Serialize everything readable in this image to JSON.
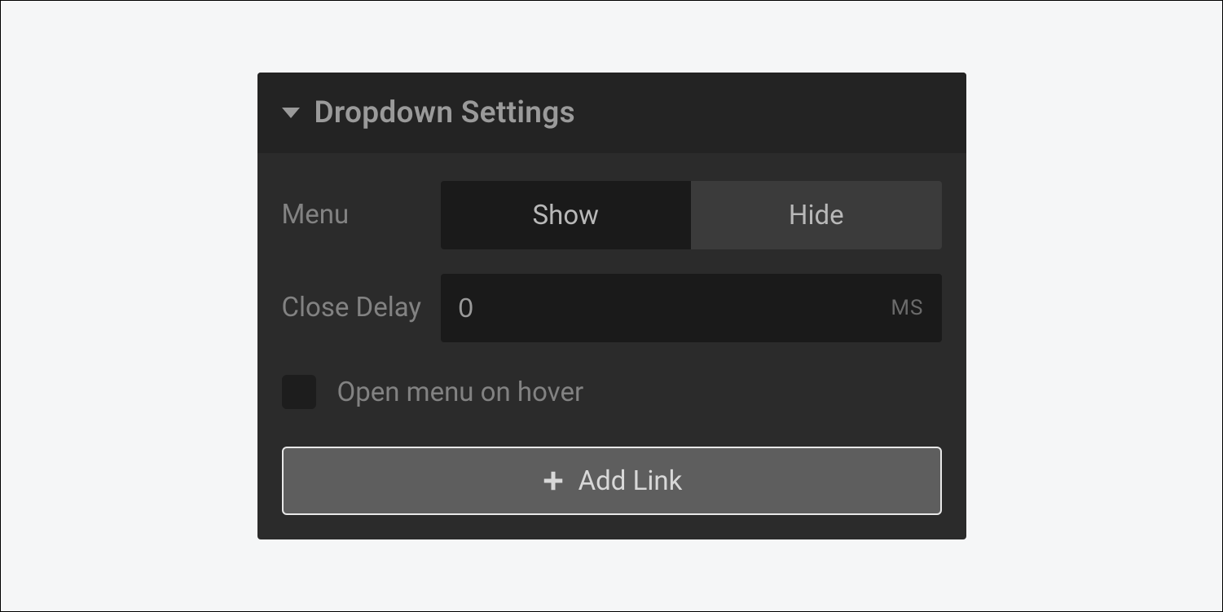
{
  "panel": {
    "title": "Dropdown Settings",
    "menu": {
      "label": "Menu",
      "show": "Show",
      "hide": "Hide"
    },
    "closeDelay": {
      "label": "Close Delay",
      "value": "0",
      "unit": "MS"
    },
    "hover": {
      "label": "Open menu on hover"
    },
    "addLink": {
      "label": "Add Link"
    }
  }
}
